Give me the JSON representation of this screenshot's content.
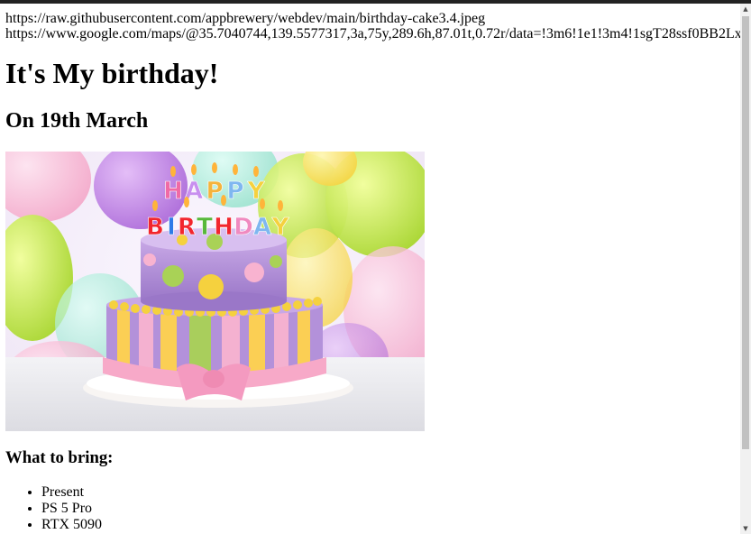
{
  "urls": [
    "https://raw.githubusercontent.com/appbrewery/webdev/main/birthday-cake3.4.jpeg",
    "https://www.google.com/maps/@35.7040744,139.5577317,3a,75y,289.6h,87.01t,0.72r/data=!3m6!1e1!3m4!1sgT28ssf0BB2Lx"
  ],
  "heading": "It's My birthday!",
  "subheading": "On 19th March",
  "image": {
    "icon": "birthday-cake-image",
    "candle_text_top": "HAPPY",
    "candle_text_bottom": "BIRTHDAY"
  },
  "bring_heading": "What to bring:",
  "bring_items": [
    "Present",
    "PS 5 Pro",
    "RTX 5090"
  ],
  "colors": {
    "topbar": "#222222",
    "scrollbar_track": "#f1f1f1",
    "scrollbar_thumb": "#c1c1c1"
  },
  "scrollbar": {
    "up_icon": "▲",
    "down_icon": "▼"
  }
}
